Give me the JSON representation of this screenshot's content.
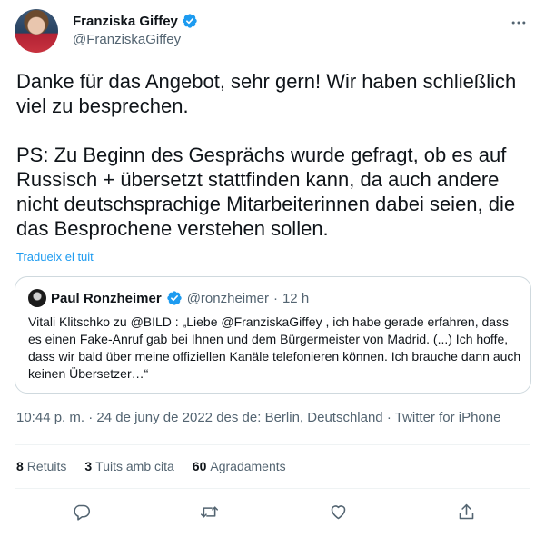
{
  "author": {
    "name": "Franziska Giffey",
    "handle": "@FranziskaGiffey"
  },
  "tweet": {
    "text": "Danke für das Angebot, sehr gern! Wir haben schließlich viel zu besprechen.\n\nPS: Zu Beginn des Gesprächs wurde gefragt, ob es auf Russisch + übersetzt stattfinden kann, da auch andere nicht deutschsprachige Mitarbeiterinnen dabei seien, die das Besprochene verstehen sollen.",
    "translate_label": "Tradueix el tuit"
  },
  "quoted": {
    "name": "Paul Ronzheimer",
    "handle": "@ronzheimer",
    "separator": "·",
    "time": "12 h",
    "text": "Vitali Klitschko zu @BILD : „Liebe @FranziskaGiffey , ich habe gerade erfahren, dass es einen Fake-Anruf gab bei Ihnen und dem Bürgermeister von Madrid. (...) Ich hoffe, dass wir bald über meine offiziellen Kanäle telefonieren können. Ich brauche dann auch keinen Übersetzer…“"
  },
  "meta": {
    "time": "10:44 p. m.",
    "dot1": "·",
    "date": "24 de juny de 2022",
    "from_prefix": "des de:",
    "location": "Berlin, Deutschland",
    "dot2": "·",
    "client": "Twitter for iPhone"
  },
  "stats": {
    "retweets_count": "8",
    "retweets_label": "Retuits",
    "quotes_count": "3",
    "quotes_label": "Tuits amb cita",
    "likes_count": "60",
    "likes_label": "Agradaments"
  },
  "colors": {
    "accent": "#1d9bf0",
    "text": "#0f1419",
    "muted": "#536471",
    "border": "#cfd9de"
  },
  "icons": {
    "verified": "verified-badge-icon",
    "more": "more-options-icon",
    "reply": "reply-icon",
    "retweet": "retweet-icon",
    "like": "heart-icon",
    "share": "share-icon"
  }
}
